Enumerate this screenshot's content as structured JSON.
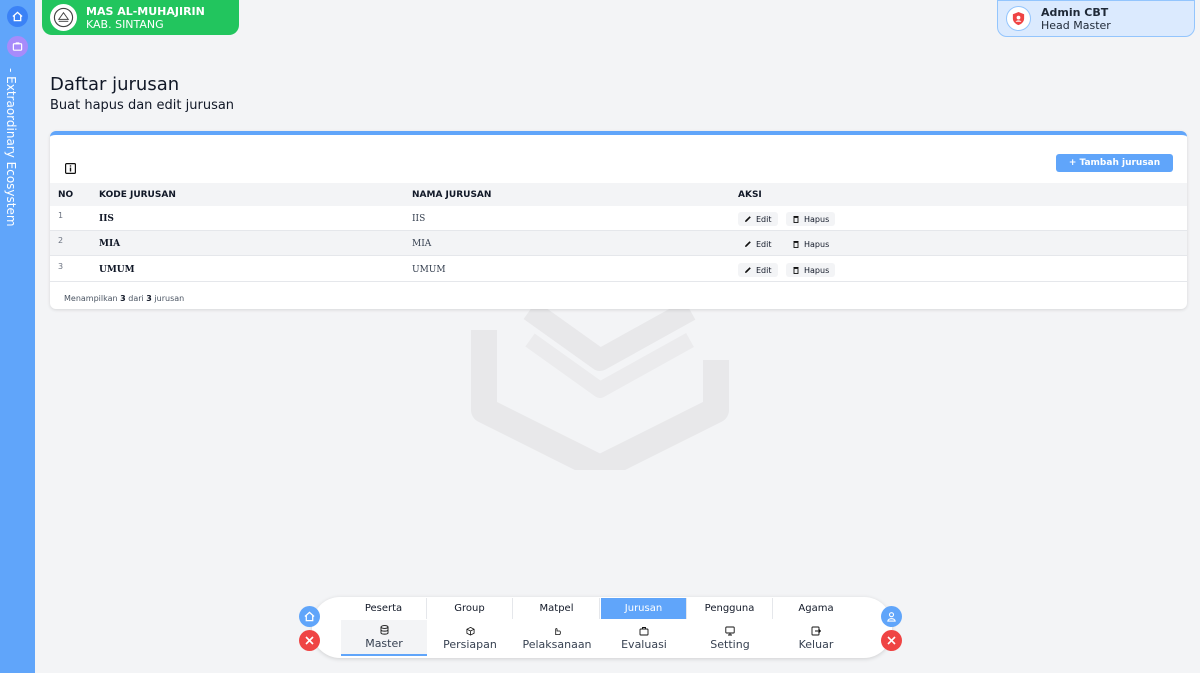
{
  "rail": {
    "text": "- Extraordinary Ecosystem",
    "home_icon": "home-icon",
    "app_icon": "app-icon"
  },
  "school": {
    "name": "MAS AL-MUHAJIRIN",
    "region": "KAB. SINTANG"
  },
  "user": {
    "name": "Admin CBT",
    "role": "Head Master"
  },
  "page": {
    "title": "Daftar jurusan",
    "subtitle": "Buat hapus dan edit jurusan"
  },
  "table": {
    "add_button": "+ Tambah jurusan",
    "columns": {
      "no": "NO",
      "kode": "KODE JURUSAN",
      "nama": "NAMA JURUSAN",
      "aksi": "AKSI"
    },
    "rows": [
      {
        "no": "1",
        "kode": "IIS",
        "nama": "IIS"
      },
      {
        "no": "2",
        "kode": "MIA",
        "nama": "MIA"
      },
      {
        "no": "3",
        "kode": "UMUM",
        "nama": "UMUM"
      }
    ],
    "edit_label": "Edit",
    "delete_label": "Hapus",
    "footer": {
      "prefix": "Menampilkan",
      "shown": "3",
      "middle": "dari",
      "total": "3",
      "suffix": "jurusan"
    }
  },
  "bottom_nav": {
    "sub_tabs": [
      "Peserta",
      "Group",
      "Matpel",
      "Jurusan",
      "Pengguna",
      "Agama"
    ],
    "active_sub_tab": "Jurusan",
    "main_tabs": [
      "Master",
      "Persiapan",
      "Pelaksanaan",
      "Evaluasi",
      "Setting",
      "Keluar"
    ],
    "active_main_tab": "Master"
  },
  "colors": {
    "accent": "#60a5fa",
    "school_green": "#22c55e",
    "danger": "#ef4444"
  }
}
